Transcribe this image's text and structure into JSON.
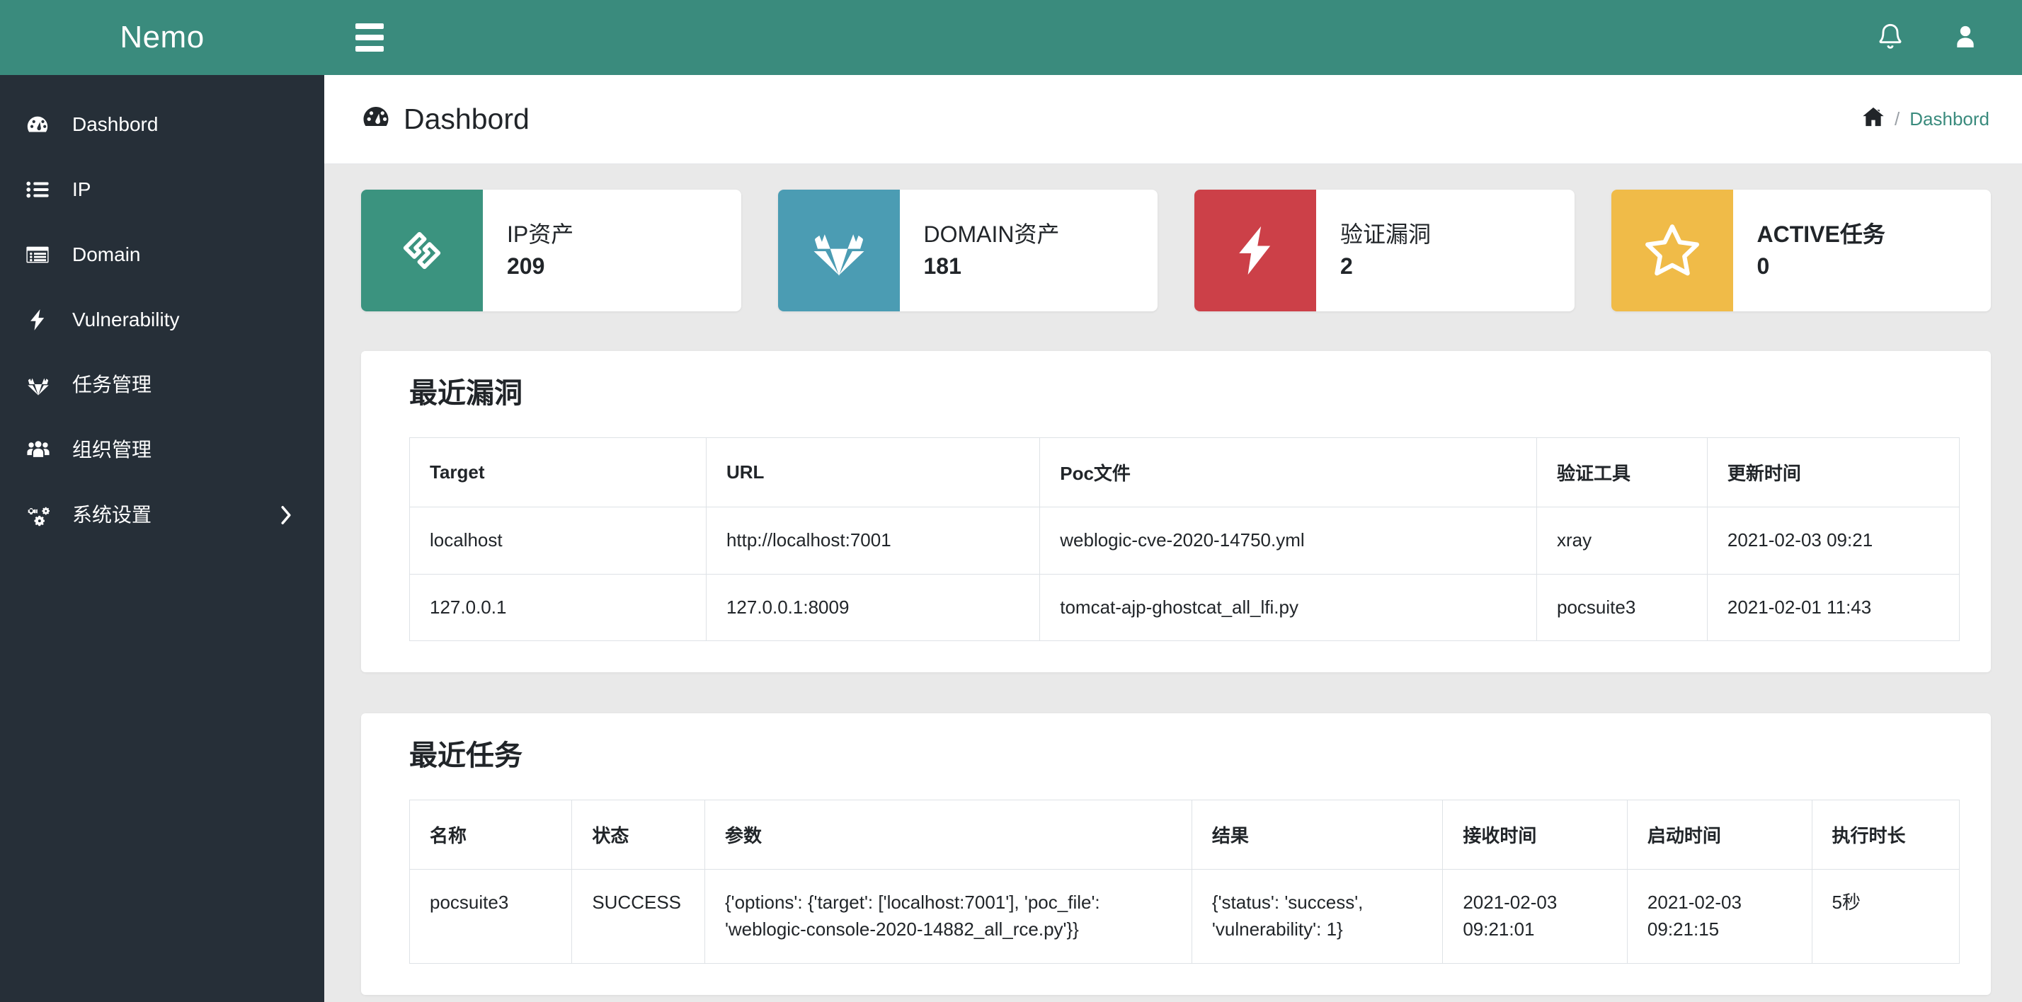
{
  "brand": {
    "name": "Nemo"
  },
  "topbar": {
    "menu_toggle": "menu",
    "notification_icon": "bell-icon",
    "user_icon": "user-icon"
  },
  "sidebar": {
    "items": [
      {
        "label": "Dashbord",
        "icon": "tachometer-icon",
        "has_chevron": false
      },
      {
        "label": "IP",
        "icon": "list-icon",
        "has_chevron": false
      },
      {
        "label": "Domain",
        "icon": "window-list-icon",
        "has_chevron": false
      },
      {
        "label": "Vulnerability",
        "icon": "bolt-icon",
        "has_chevron": false
      },
      {
        "label": "任务管理",
        "icon": "gitlab-fox-icon",
        "has_chevron": false
      },
      {
        "label": "组织管理",
        "icon": "users-icon",
        "has_chevron": false
      },
      {
        "label": "系统设置",
        "icon": "cogs-icon",
        "has_chevron": true,
        "chevron": "›"
      }
    ]
  },
  "page": {
    "title": "Dashbord",
    "title_icon": "tachometer-icon",
    "breadcrumb": {
      "home_icon": "home-icon",
      "separator": "/",
      "current": "Dashbord"
    }
  },
  "cards": [
    {
      "title": "IP资产",
      "value": "209",
      "color": "#3b937f",
      "icon": "ip-asset-icon",
      "bold_title": false
    },
    {
      "title": "DOMAIN资产",
      "value": "181",
      "color": "#4b9cb3",
      "icon": "domain-fox-icon",
      "bold_title": false
    },
    {
      "title": "验证漏洞",
      "value": "2",
      "color": "#cc4048",
      "icon": "bolt-icon",
      "bold_title": false
    },
    {
      "title": "ACTIVE任务",
      "value": "0",
      "color": "#f0bb48",
      "icon": "star-icon",
      "bold_title": true
    }
  ],
  "vuln_panel": {
    "title": "最近漏洞",
    "columns": [
      "Target",
      "URL",
      "Poc文件",
      "验证工具",
      "更新时间"
    ],
    "rows": [
      {
        "target": "localhost",
        "url": "http://localhost:7001",
        "poc_file": "weblogic-cve-2020-14750.yml",
        "tool": "xray",
        "updated": "2021-02-03 09:21"
      },
      {
        "target": "127.0.0.1",
        "url": "127.0.0.1:8009",
        "poc_file": "tomcat-ajp-ghostcat_all_lfi.py",
        "tool": "pocsuite3",
        "updated": "2021-02-01 11:43"
      }
    ]
  },
  "task_panel": {
    "title": "最近任务",
    "columns": [
      "名称",
      "状态",
      "参数",
      "结果",
      "接收时间",
      "启动时间",
      "执行时长"
    ],
    "rows": [
      {
        "name": "pocsuite3",
        "status": "SUCCESS",
        "params": "{'options': {'target': ['localhost:7001'], 'poc_file': 'weblogic-console-2020-14882_all_rce.py'}}",
        "result": "{'status': 'success', 'vulnerability': 1}",
        "received": "2021-02-03 09:21:01",
        "started": "2021-02-03 09:21:15",
        "duration": "5秒"
      }
    ]
  },
  "colors": {
    "brand_green": "#3a8b7d",
    "sidebar_dark": "#262f38",
    "page_bg": "#e9e9e9"
  }
}
